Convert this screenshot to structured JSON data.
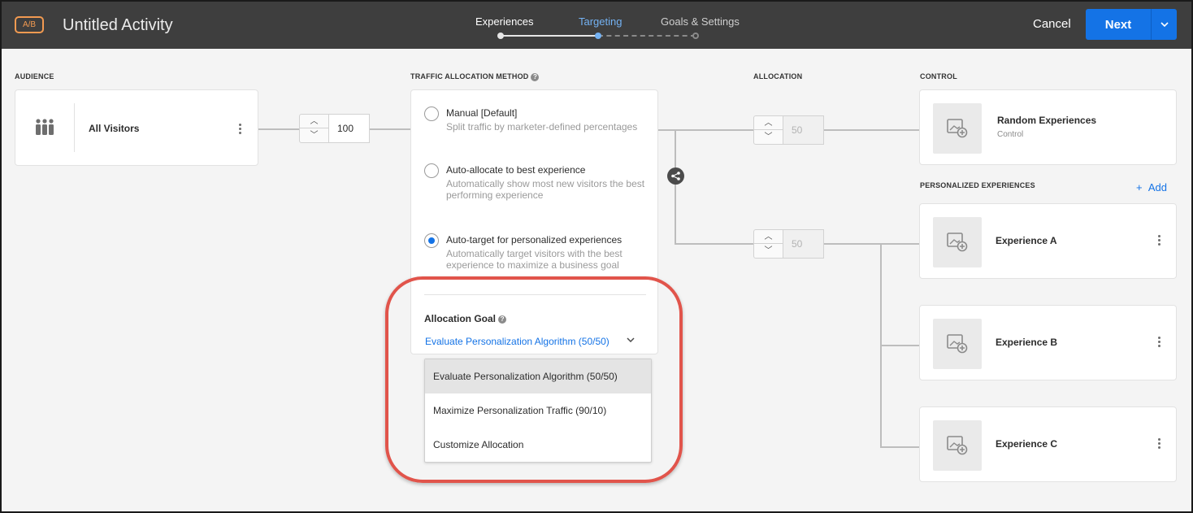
{
  "header": {
    "badge": "A/B",
    "title": "Untitled Activity",
    "steps": [
      {
        "label": "Experiences",
        "state": "completed"
      },
      {
        "label": "Targeting",
        "state": "active"
      },
      {
        "label": "Goals & Settings",
        "state": "upcoming"
      }
    ],
    "cancel_label": "Cancel",
    "next_label": "Next"
  },
  "sections": {
    "audience": "AUDIENCE",
    "traffic": "TRAFFIC ALLOCATION METHOD",
    "allocation": "ALLOCATION",
    "control": "CONTROL",
    "personalized": "PERSONALIZED EXPERIENCES"
  },
  "audience": {
    "name": "All Visitors",
    "traffic_value": "100"
  },
  "traffic": {
    "options": [
      {
        "title": "Manual [Default]",
        "desc": "Split traffic by marketer-defined percentages",
        "checked": false
      },
      {
        "title": "Auto-allocate to best experience",
        "desc": "Automatically show most new visitors the best performing experience",
        "checked": false
      },
      {
        "title": "Auto-target for personalized experiences",
        "desc": "Automatically target visitors with the best experience to maximize a business goal",
        "checked": true
      }
    ],
    "goal_label": "Allocation Goal",
    "goal_value": "Evaluate Personalization Algorithm (50/50)",
    "dropdown_options": [
      "Evaluate Personalization Algorithm (50/50)",
      "Maximize Personalization Traffic (90/10)",
      "Customize Allocation"
    ]
  },
  "allocation": {
    "control_value": "50",
    "personalized_value": "50"
  },
  "control": {
    "name": "Random Experiences",
    "sub": "Control"
  },
  "personalized": {
    "add_label": "Add",
    "experiences": [
      "Experience A",
      "Experience B",
      "Experience C"
    ]
  },
  "colors": {
    "header_bg": "#3e3e3e",
    "accent": "#1473e6",
    "badge": "#f29a51",
    "highlight": "#e1544b"
  }
}
